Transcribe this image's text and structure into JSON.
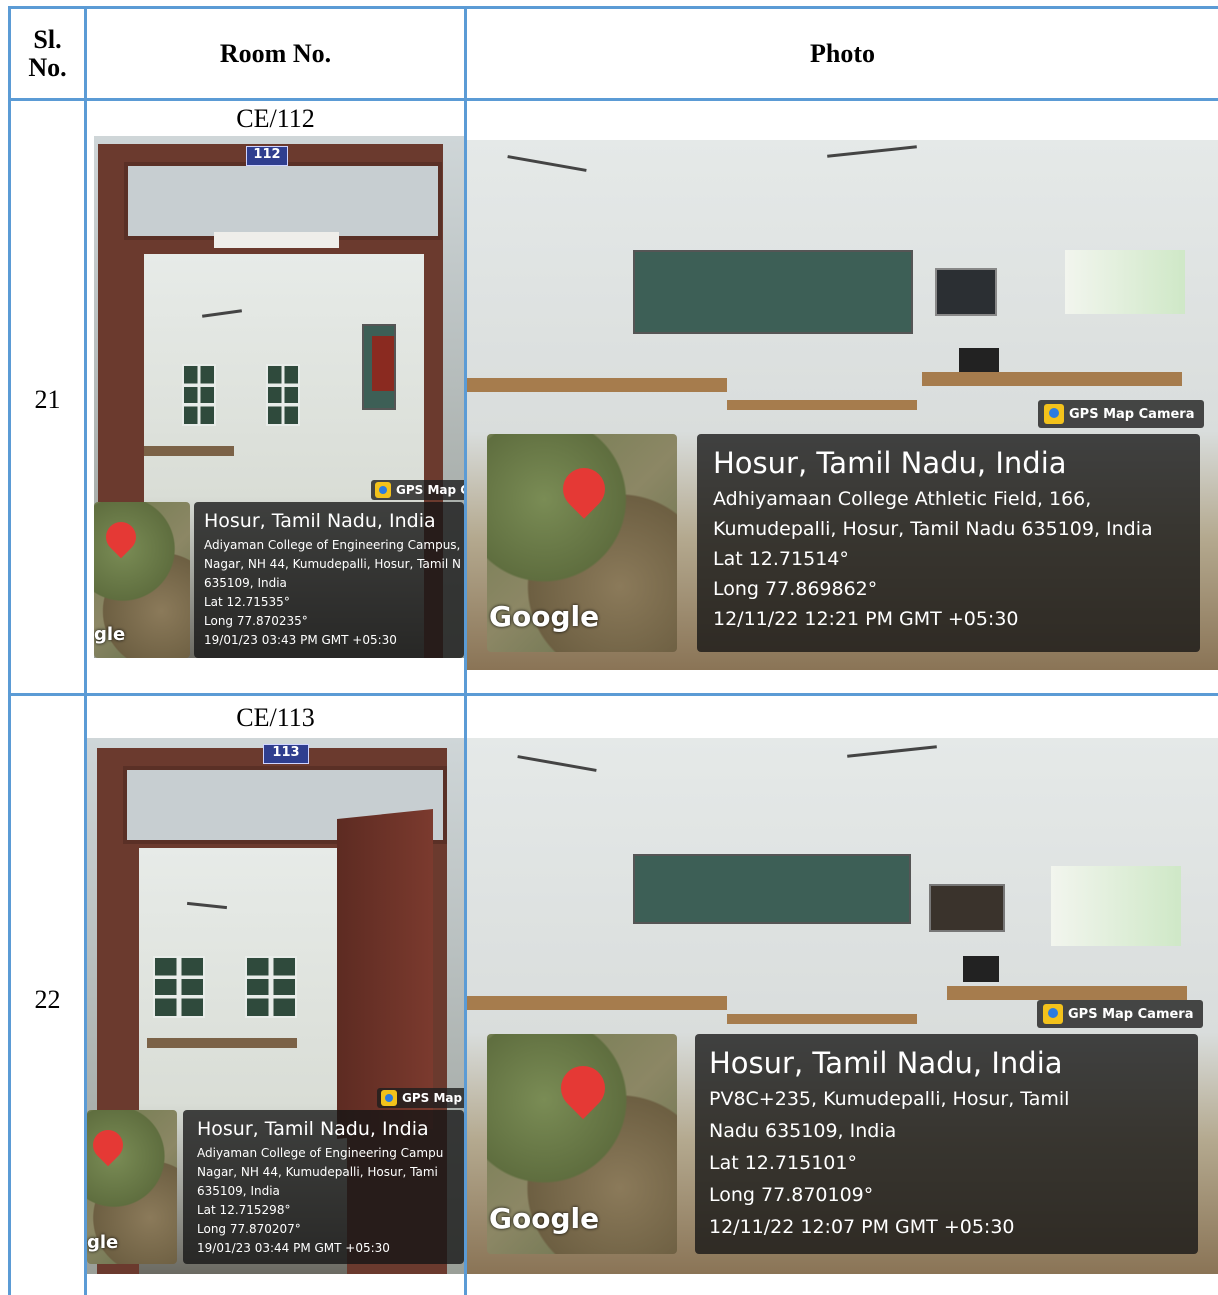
{
  "table": {
    "headers": {
      "sl_no": "Sl.\nNo.",
      "room_no": "Room No.",
      "photo": "Photo"
    },
    "rows": [
      {
        "sl_no": "21",
        "room_no": "CE/112",
        "door_tag": "112",
        "door_gps": {
          "badge": "GPS Map C",
          "title": "Hosur, Tamil Nadu, India",
          "address_line1": "Adiyaman College of Engineering Campus,",
          "address_line2": "Nagar, NH 44, Kumudepalli, Hosur, Tamil N",
          "address_line3": "635109, India",
          "lat": "Lat 12.71535°",
          "long": "Long 77.870235°",
          "datetime": "19/01/23 03:43 PM GMT +05:30",
          "google": "gle"
        },
        "photo_gps": {
          "badge": "GPS Map Camera",
          "title": "Hosur, Tamil Nadu, India",
          "address_line1": "Adhiyamaan College Athletic Field, 166,",
          "address_line2": "Kumudepalli, Hosur, Tamil Nadu 635109, India",
          "lat": "Lat 12.71514°",
          "long": "Long 77.869862°",
          "datetime": "12/11/22 12:21 PM GMT +05:30",
          "google": "Google"
        }
      },
      {
        "sl_no": "22",
        "room_no": "CE/113",
        "door_tag": "113",
        "door_gps": {
          "badge": "GPS Map",
          "title": "Hosur, Tamil Nadu, India",
          "address_line1": "Adiyaman College of Engineering Campu",
          "address_line2": "Nagar, NH 44, Kumudepalli, Hosur, Tami",
          "address_line3": "635109, India",
          "lat": "Lat 12.715298°",
          "long": "Long 77.870207°",
          "datetime": "19/01/23 03:44 PM GMT +05:30",
          "google": "gle"
        },
        "photo_gps": {
          "badge": "GPS Map Camera",
          "title": "Hosur, Tamil Nadu, India",
          "address_line1": "PV8C+235, Kumudepalli, Hosur, Tamil",
          "address_line2": "Nadu 635109, India",
          "lat": "Lat 12.715101°",
          "long": "Long 77.870109°",
          "datetime": "12/11/22 12:07 PM GMT +05:30",
          "google": "Google"
        }
      }
    ]
  }
}
